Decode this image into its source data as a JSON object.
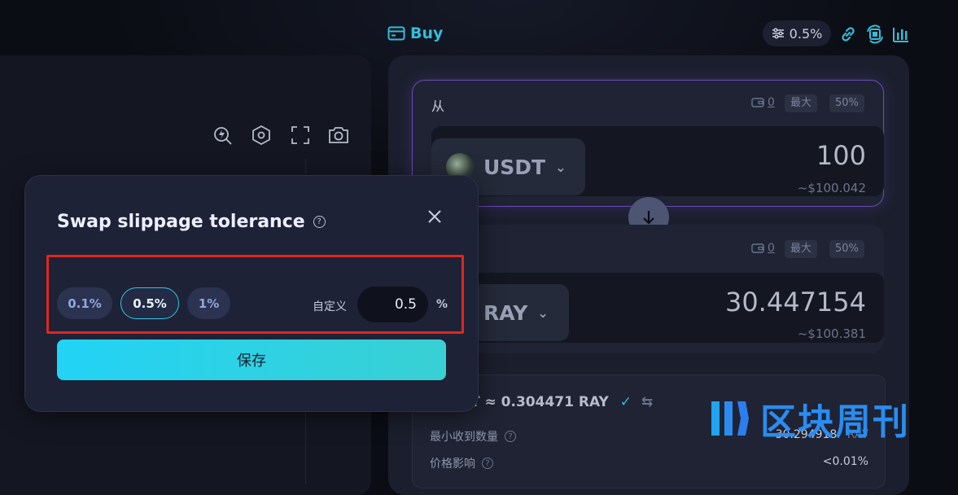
{
  "top_bar": {
    "buy_label": "Buy",
    "slippage_value": "0.5%",
    "icons": [
      "link-icon",
      "swap-flip-icon",
      "chart-bars-icon"
    ]
  },
  "chart_panel": {
    "tools": [
      "flash-search-icon",
      "hexagon-icon",
      "fullscreen-icon",
      "camera-icon"
    ]
  },
  "swap": {
    "from": {
      "label": "从",
      "balance": "0",
      "max_label": "最大",
      "half_label": "50%",
      "token": "USDT",
      "amount": "100",
      "usd": "~$100.042"
    },
    "to": {
      "balance": "0",
      "max_label": "最大",
      "half_label": "50%",
      "token": "RAY",
      "amount": "30.447154",
      "usd": "~$100.381"
    },
    "rate": "T ≈ 0.304471 RAY",
    "min_received_label": "最小收到数量",
    "min_received_value": "30.294918",
    "min_received_unit": "RAY",
    "price_impact_label": "价格影响",
    "price_impact_value": "<0.01%"
  },
  "modal": {
    "title": "Swap slippage tolerance",
    "options": [
      "0.1%",
      "0.5%",
      "1%"
    ],
    "selected": "0.5%",
    "custom_label": "自定义",
    "custom_value": "0.5",
    "percent": "%",
    "save_label": "保存"
  },
  "watermark": {
    "text": "区块周刊"
  },
  "colors": {
    "accent": "#33bdd9",
    "highlight": "#e0261f",
    "save_gradient_start": "#22d3f5"
  }
}
